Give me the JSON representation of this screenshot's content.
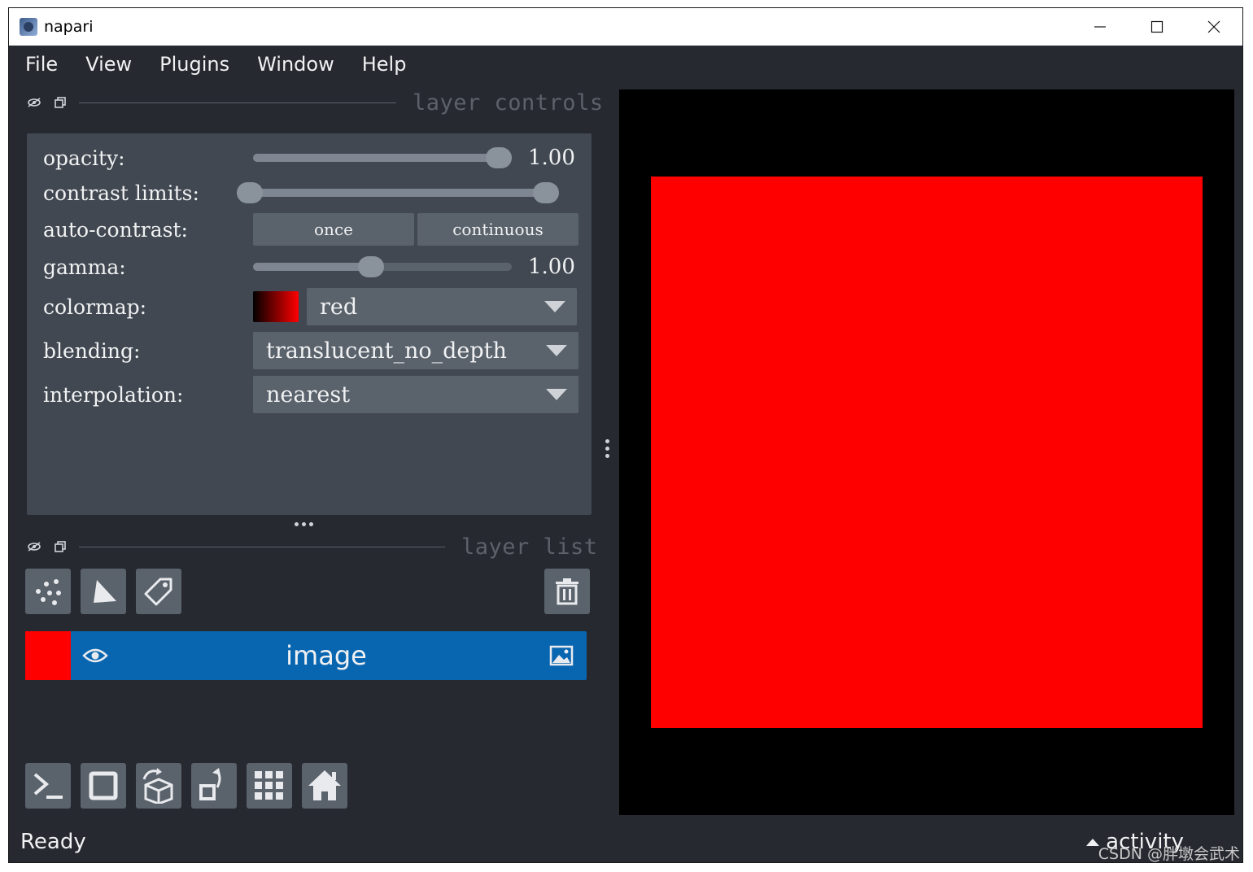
{
  "window": {
    "title": "napari",
    "controls": [
      "minimize",
      "maximize",
      "close"
    ]
  },
  "menu": [
    "File",
    "View",
    "Plugins",
    "Window",
    "Help"
  ],
  "layer_controls": {
    "title": "layer controls",
    "opacity": {
      "label": "opacity:",
      "value": "1.00",
      "level": 1.0
    },
    "contrast_limits": {
      "label": "contrast limits:",
      "low": 0.0,
      "high": 1.0
    },
    "auto_contrast": {
      "label": "auto-contrast:",
      "buttons": [
        "once",
        "continuous"
      ]
    },
    "gamma": {
      "label": "gamma:",
      "value": "1.00",
      "level": 0.45
    },
    "colormap": {
      "label": "colormap:",
      "value": "red"
    },
    "blending": {
      "label": "blending:",
      "value": "translucent_no_depth"
    },
    "interpolation": {
      "label": "interpolation:",
      "value": "nearest"
    }
  },
  "layer_list": {
    "title": "layer list",
    "layers": [
      {
        "name": "image",
        "thumb_color": "#ff0000",
        "visible": true,
        "type": "image"
      }
    ]
  },
  "viewer_buttons": [
    "console",
    "ndisplay",
    "roll-dims",
    "transpose",
    "grid",
    "home"
  ],
  "canvas": {
    "background": "#000000",
    "image_color": "#ff0000"
  },
  "status": {
    "text": "Ready",
    "activity": "activity"
  },
  "watermark": "CSDN @胖墩会武术",
  "colors": {
    "panel_bg": "#262930",
    "control_bg": "#414851",
    "widget_bg": "#5a626c",
    "selected_layer": "#0866b1",
    "text": "#f0f1f2"
  }
}
